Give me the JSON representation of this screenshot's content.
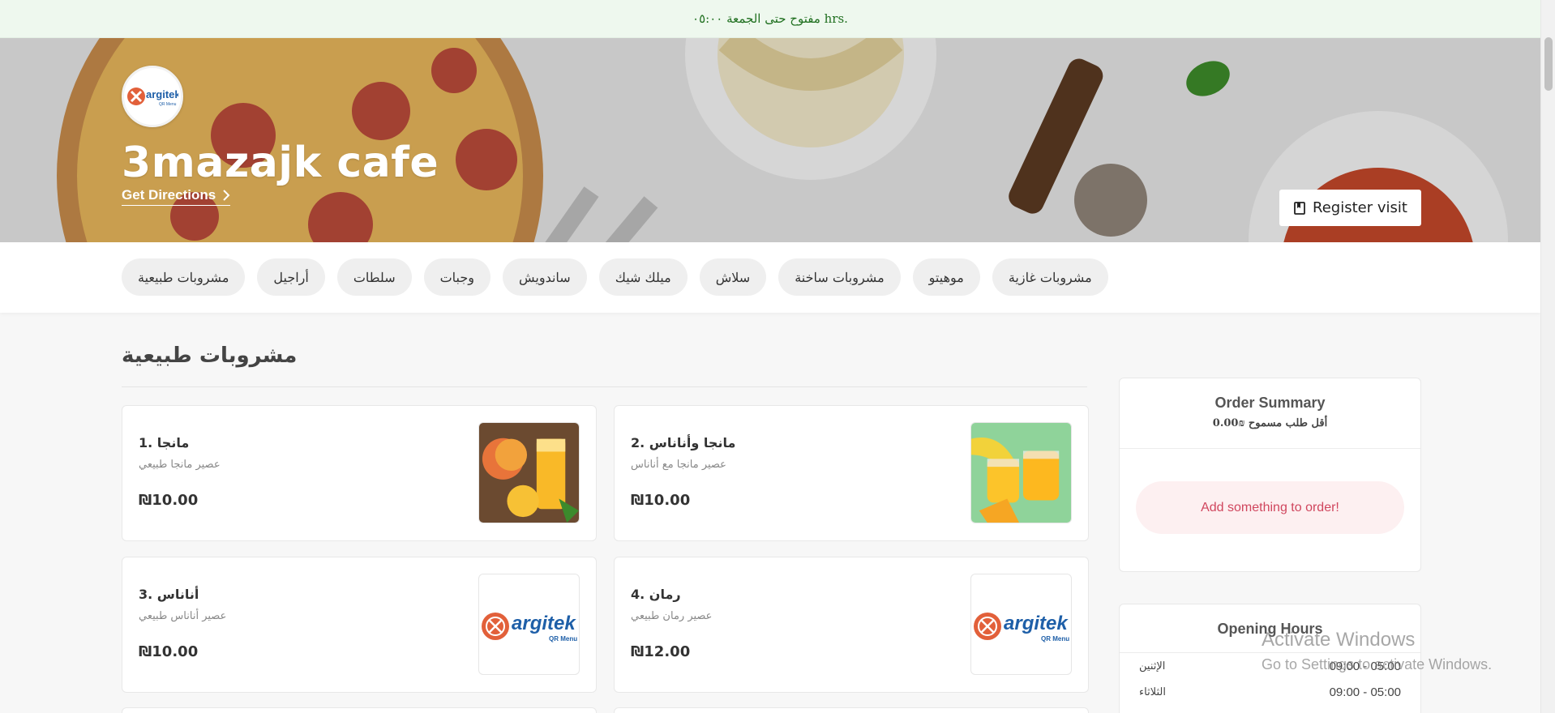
{
  "notice": {
    "text": "مفتوح حتى الجمعة ٠٥:٠٠ hrs."
  },
  "hero": {
    "logo_text": "argitek",
    "logo_sub": "QR Menu",
    "title": "3mazajk cafe",
    "directions_label": "Get Directions",
    "register_label": "Register visit"
  },
  "categories": [
    "مشروبات طبيعية",
    "أراجيل",
    "سلطات",
    "وجبات",
    "ساندويش",
    "ميلك شيك",
    "سلاش",
    "مشروبات ساخنة",
    "موهيتو",
    "مشروبات غازية"
  ],
  "section": {
    "title": "مشروبات طبيعية"
  },
  "items": [
    {
      "name": "مانجا .1",
      "desc": "عصير مانجا طبيعي",
      "price": "₪10.00",
      "image": "mango-juice"
    },
    {
      "name": "مانجا وأناناس .2",
      "desc": "عصير مانجا مع أناناس",
      "price": "₪10.00",
      "image": "mango-pineapple"
    },
    {
      "name": "أناناس .3",
      "desc": "عصير أناناس طبيعي",
      "price": "₪10.00",
      "image": "argitek-logo"
    },
    {
      "name": "رمان .4",
      "desc": "عصير رمان طبيعي",
      "price": "₪12.00",
      "image": "argitek-logo"
    }
  ],
  "summary": {
    "title": "Order Summary",
    "minimum": "أقل طلب مسموح ₪0.00",
    "empty": "Add something to order!"
  },
  "hours": {
    "title": "Opening Hours",
    "rows": [
      {
        "day": "الإثنين",
        "time": "09:00 - 05:00"
      },
      {
        "day": "الثلاثاء",
        "time": "09:00 - 05:00"
      }
    ]
  },
  "watermark": {
    "line1": "Activate Windows",
    "line2": "Go to Settings to activate Windows."
  },
  "colors": {
    "accent": "#d0465e",
    "notice_bg": "#eef8ee",
    "notice_text": "#1f6f1f"
  }
}
